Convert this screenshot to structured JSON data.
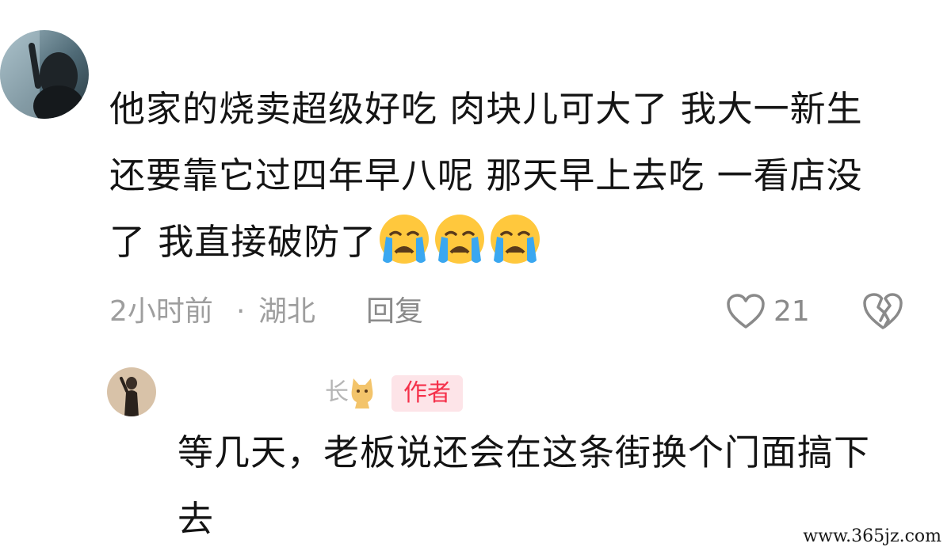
{
  "comment": {
    "text_lines": [
      "他家的烧卖超级好吃 肉块儿可大了 我大一新生",
      "还要靠它过四年早八呢 那天早上去吃 一看店没",
      "了 我直接破防了"
    ],
    "emoji_count": 3,
    "emoji_icon": "crying-face-icon",
    "time": "2小时前",
    "separator": "·",
    "location": "湖北",
    "reply_label": "回复",
    "like_count": "21"
  },
  "reply": {
    "username": "长",
    "author_badge": "作者",
    "badge_color": "#f5304a",
    "badge_bg": "#fde4e8",
    "text_lines": [
      "等几天，老板说还会在这条街换个门面搞下",
      "去"
    ]
  },
  "watermark": "www.365jz.com"
}
